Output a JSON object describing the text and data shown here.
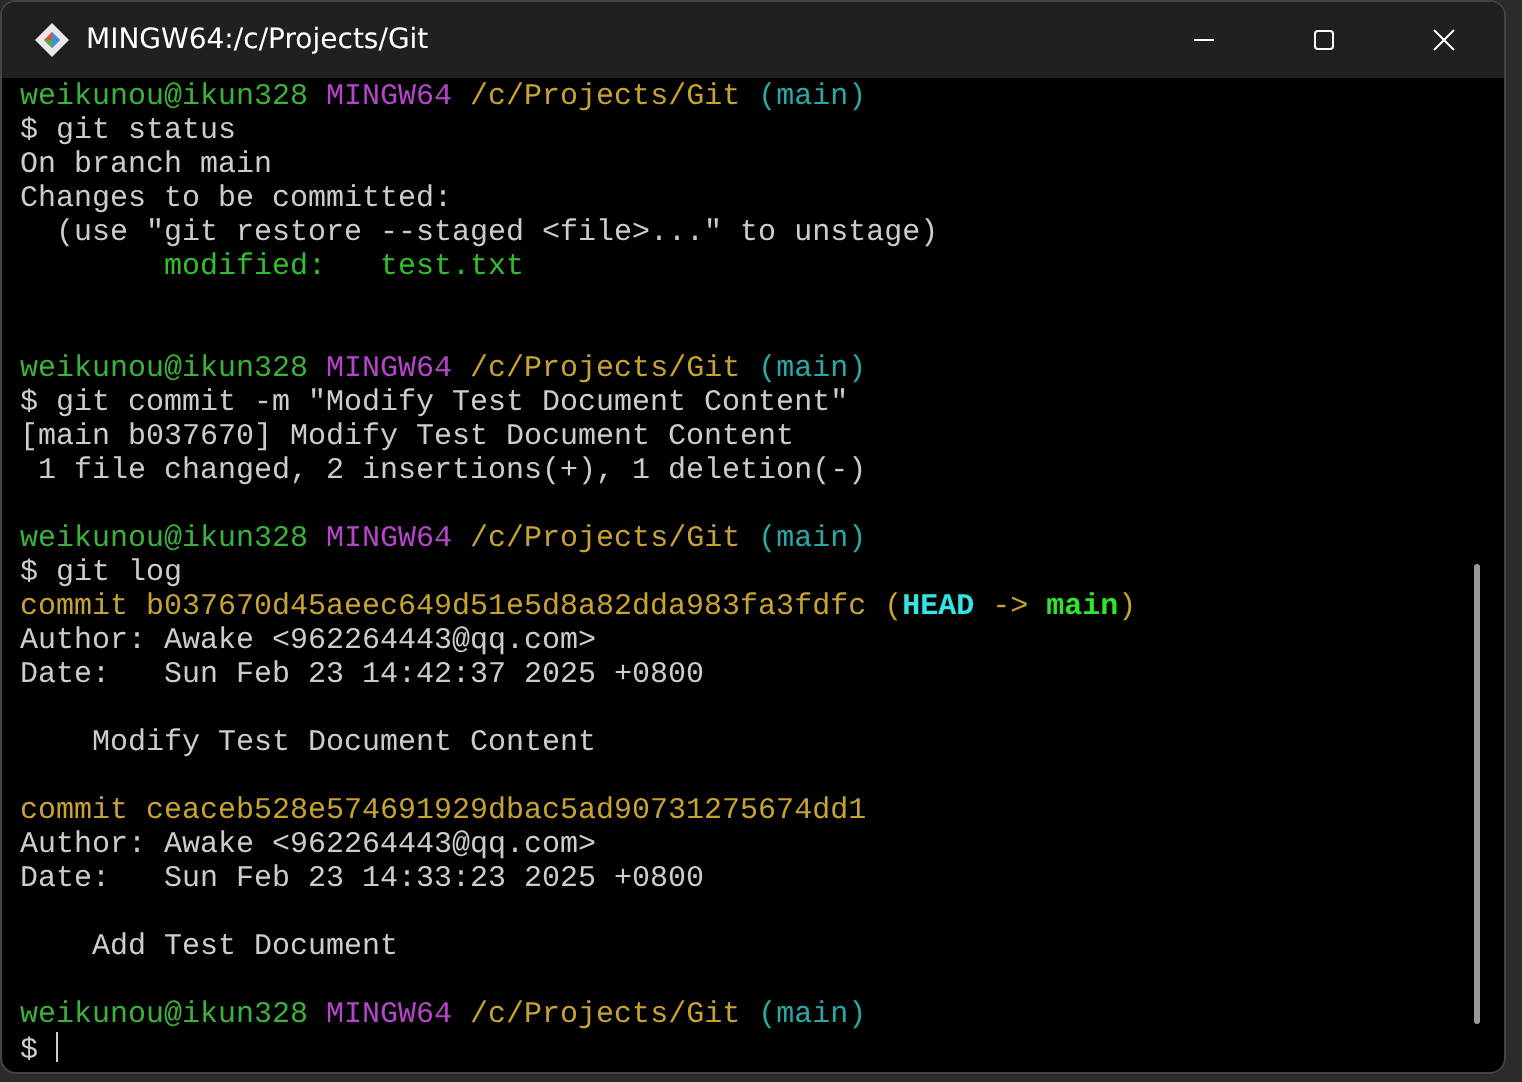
{
  "window": {
    "title": "MINGW64:/c/Projects/Git"
  },
  "terminal": {
    "lines": [
      {
        "segments": [
          {
            "kind": "user",
            "text": "weikunou@ikun328"
          },
          {
            "kind": "host",
            "text": " MINGW64"
          },
          {
            "kind": "path",
            "text": " /c/Projects/Git"
          },
          {
            "kind": "branch",
            "text": " (main)"
          }
        ]
      },
      {
        "segments": [
          {
            "kind": "plain",
            "text": "$ git status"
          }
        ]
      },
      {
        "segments": [
          {
            "kind": "plain",
            "text": "On branch main"
          }
        ]
      },
      {
        "segments": [
          {
            "kind": "plain",
            "text": "Changes to be committed:"
          }
        ]
      },
      {
        "segments": [
          {
            "kind": "plain",
            "text": "  (use \"git restore --staged <file>...\" to unstage)"
          }
        ]
      },
      {
        "segments": [
          {
            "kind": "staged",
            "text": "        modified:   test.txt"
          }
        ]
      },
      {
        "kind": "blank"
      },
      {
        "kind": "blank"
      },
      {
        "segments": [
          {
            "kind": "user",
            "text": "weikunou@ikun328"
          },
          {
            "kind": "host",
            "text": " MINGW64"
          },
          {
            "kind": "path",
            "text": " /c/Projects/Git"
          },
          {
            "kind": "branch",
            "text": " (main)"
          }
        ]
      },
      {
        "segments": [
          {
            "kind": "plain",
            "text": "$ git commit -m \"Modify Test Document Content\""
          }
        ]
      },
      {
        "segments": [
          {
            "kind": "plain",
            "text": "[main b037670] Modify Test Document Content"
          }
        ]
      },
      {
        "segments": [
          {
            "kind": "plain",
            "text": " 1 file changed, 2 insertions(+), 1 deletion(-)"
          }
        ]
      },
      {
        "kind": "blank"
      },
      {
        "segments": [
          {
            "kind": "user",
            "text": "weikunou@ikun328"
          },
          {
            "kind": "host",
            "text": " MINGW64"
          },
          {
            "kind": "path",
            "text": " /c/Projects/Git"
          },
          {
            "kind": "branch",
            "text": " (main)"
          }
        ]
      },
      {
        "segments": [
          {
            "kind": "plain",
            "text": "$ git log"
          }
        ]
      },
      {
        "segments": [
          {
            "kind": "commit",
            "text": "commit b037670d45aeec649d51e5d8a82dda983fa3fdfc ("
          },
          {
            "kind": "head",
            "text": "HEAD"
          },
          {
            "kind": "commit",
            "text": " -> "
          },
          {
            "kind": "local",
            "text": "main"
          },
          {
            "kind": "commit",
            "text": ")"
          }
        ]
      },
      {
        "segments": [
          {
            "kind": "plain",
            "text": "Author: Awake <962264443@qq.com>"
          }
        ]
      },
      {
        "segments": [
          {
            "kind": "plain",
            "text": "Date:   Sun Feb 23 14:42:37 2025 +0800"
          }
        ]
      },
      {
        "kind": "blank"
      },
      {
        "segments": [
          {
            "kind": "plain",
            "text": "    Modify Test Document Content"
          }
        ]
      },
      {
        "kind": "blank"
      },
      {
        "segments": [
          {
            "kind": "commit",
            "text": "commit ceaceb528e574691929dbac5ad90731275674dd1"
          }
        ]
      },
      {
        "segments": [
          {
            "kind": "plain",
            "text": "Author: Awake <962264443@qq.com>"
          }
        ]
      },
      {
        "segments": [
          {
            "kind": "plain",
            "text": "Date:   Sun Feb 23 14:33:23 2025 +0800"
          }
        ]
      },
      {
        "kind": "blank"
      },
      {
        "segments": [
          {
            "kind": "plain",
            "text": "    Add Test Document"
          }
        ]
      },
      {
        "kind": "blank"
      },
      {
        "segments": [
          {
            "kind": "user",
            "text": "weikunou@ikun328"
          },
          {
            "kind": "host",
            "text": " MINGW64"
          },
          {
            "kind": "path",
            "text": " /c/Projects/Git"
          },
          {
            "kind": "branch",
            "text": " (main)"
          }
        ]
      },
      {
        "segments": [
          {
            "kind": "plain",
            "text": "$ "
          }
        ],
        "cursor": true
      }
    ]
  }
}
